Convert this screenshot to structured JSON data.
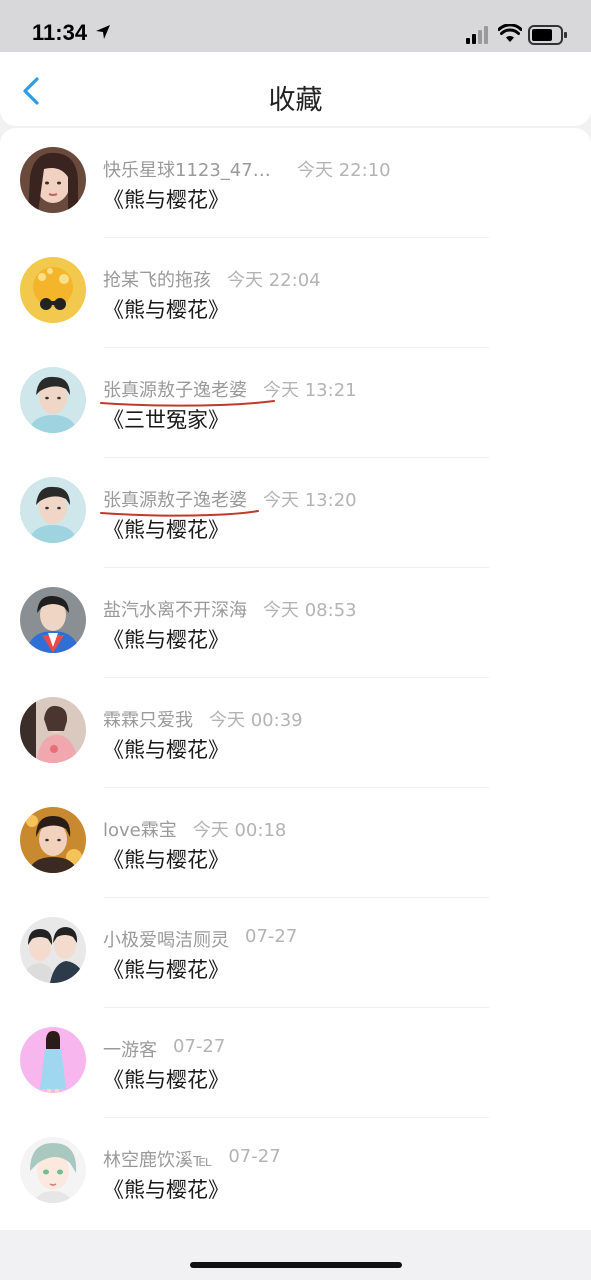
{
  "status_bar": {
    "time": "11:34"
  },
  "nav": {
    "title": "收藏"
  },
  "favorites": [
    {
      "user": "快乐星球1123_471...",
      "time": "今天 22:10",
      "title": "《熊与樱花》"
    },
    {
      "user": "抢某飞的拖孩",
      "time": "今天 22:04",
      "title": "《熊与樱花》"
    },
    {
      "user": "张真源敖子逸老婆",
      "time": "今天 13:21",
      "title": "《三世冤家》"
    },
    {
      "user": "张真源敖子逸老婆",
      "time": "今天 13:20",
      "title": "《熊与樱花》"
    },
    {
      "user": "盐汽水离不开深海",
      "time": "今天 08:53",
      "title": "《熊与樱花》"
    },
    {
      "user": "霖霖只爱我",
      "time": "今天 00:39",
      "title": "《熊与樱花》"
    },
    {
      "user": "love霖宝",
      "time": "今天 00:18",
      "title": "《熊与樱花》"
    },
    {
      "user": "小极爱喝洁厕灵",
      "time": "07-27",
      "title": "《熊与樱花》"
    },
    {
      "user": "一游客",
      "time": "07-27",
      "title": "《熊与樱花》"
    },
    {
      "user": "林空鹿饮溪℡",
      "time": "07-27",
      "title": "《熊与樱花》"
    }
  ]
}
